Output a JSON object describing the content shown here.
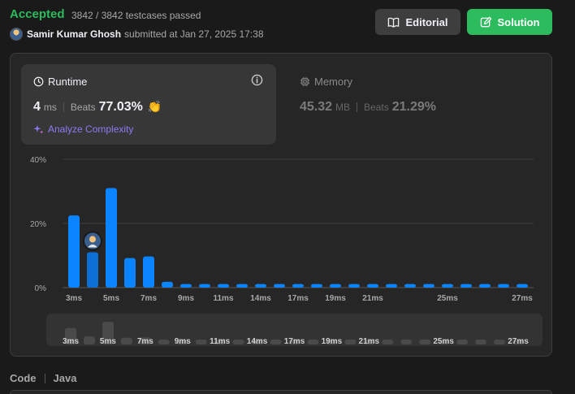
{
  "header": {
    "status": "Accepted",
    "testcases": "3842 / 3842 testcases passed",
    "user_name": "Samir Kumar Ghosh",
    "submitted_at": "submitted at Jan 27, 2025 17:38",
    "editorial_label": "Editorial",
    "solution_label": "Solution"
  },
  "runtime": {
    "title": "Runtime",
    "value": "4",
    "unit": "ms",
    "beats_label": "Beats",
    "beats_value": "77.03%",
    "analyze_label": "Analyze Complexity"
  },
  "memory": {
    "title": "Memory",
    "value": "45.32",
    "unit": "MB",
    "beats_label": "Beats",
    "beats_value": "21.29%"
  },
  "code": {
    "label": "Code",
    "language": "Java"
  },
  "colors": {
    "accepted": "#2cbb5d",
    "bar": "#0a84ff",
    "bar_active": "#0a84ff",
    "analyze": "#8a7cf4"
  },
  "chart_data": {
    "type": "bar",
    "x": [
      3,
      4,
      5,
      6,
      7,
      8,
      9,
      10,
      11,
      12,
      13,
      14,
      15,
      16,
      17,
      18,
      19,
      20,
      21,
      22,
      23,
      24,
      25,
      26,
      27
    ],
    "values": [
      22.5,
      11,
      31,
      9.2,
      9.7,
      1.8,
      1.1,
      1.1,
      1.1,
      1.1,
      1.1,
      1.1,
      1.1,
      1.1,
      1.1,
      1.1,
      1.1,
      1.1,
      1.1,
      1.1,
      1.1,
      1.1,
      1.1,
      1.1,
      1.1
    ],
    "user_x": 4,
    "tick_labels": [
      "3ms",
      "5ms",
      "7ms",
      "9ms",
      "11ms",
      "14ms",
      "17ms",
      "19ms",
      "21ms",
      "25ms",
      "27ms"
    ],
    "tick_x": [
      3,
      5,
      7,
      9,
      11,
      13,
      15,
      17,
      19,
      21,
      23,
      25,
      27
    ],
    "y_ticks": [
      "0%",
      "20%",
      "40%"
    ],
    "y_tick_values": [
      0,
      20,
      40
    ],
    "ylim": [
      0,
      40
    ],
    "grid": true,
    "minimap_tick_labels": [
      "3ms",
      "5ms",
      "7ms",
      "9ms",
      "11ms",
      "14ms",
      "17ms",
      "19ms",
      "21ms",
      "25ms",
      "27ms"
    ]
  }
}
